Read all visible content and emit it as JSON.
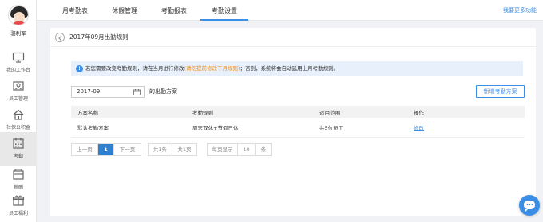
{
  "user": {
    "name": "骆利军"
  },
  "sidebar": {
    "items": [
      {
        "label": "我的工作台",
        "icon": "monitor-icon"
      },
      {
        "label": "员工管理",
        "icon": "users-icon"
      },
      {
        "label": "社保公积金",
        "icon": "home-icon"
      },
      {
        "label": "考勤",
        "icon": "calendar-icon"
      },
      {
        "label": "薪酬",
        "icon": "wallet-icon"
      },
      {
        "label": "员工福利",
        "icon": "gift-icon"
      }
    ],
    "active_index": 3
  },
  "topnav": {
    "tabs": [
      {
        "label": "月考勤表"
      },
      {
        "label": "休假管理"
      },
      {
        "label": "考勤报表"
      },
      {
        "label": "考勤设置"
      }
    ],
    "active_index": 3,
    "more_link": "我要更多功能"
  },
  "panel": {
    "title": "2017年09月出勤规则",
    "notice": {
      "prefix": "若您需要改变考勤规则，请在当月进行修改",
      "warning": "(请勿提前修改下月规则)",
      "suffix": "；否则，系统将会自动延用上月考勤规则。"
    },
    "month_value": "2017-09",
    "month_suffix": "的出勤方案",
    "add_button": "新增考勤方案",
    "table": {
      "headers": [
        "方案名称",
        "考勤规则",
        "适用范围",
        "操作"
      ],
      "rows": [
        {
          "name": "默认考勤方案",
          "rule": "周末双休+节假日休",
          "scope": "共5位员工",
          "action": "修改"
        }
      ]
    },
    "pager": {
      "prev": "上一页",
      "current": "1",
      "next": "下一页",
      "total_items": "共1条",
      "total_pages": "共1页",
      "per_page_label": "每页显示",
      "per_page_value": "10",
      "per_page_unit": "条"
    }
  },
  "colors": {
    "accent": "#3a8ee6",
    "warning": "#f08c1f",
    "notice_bg": "#e8f1fb"
  }
}
